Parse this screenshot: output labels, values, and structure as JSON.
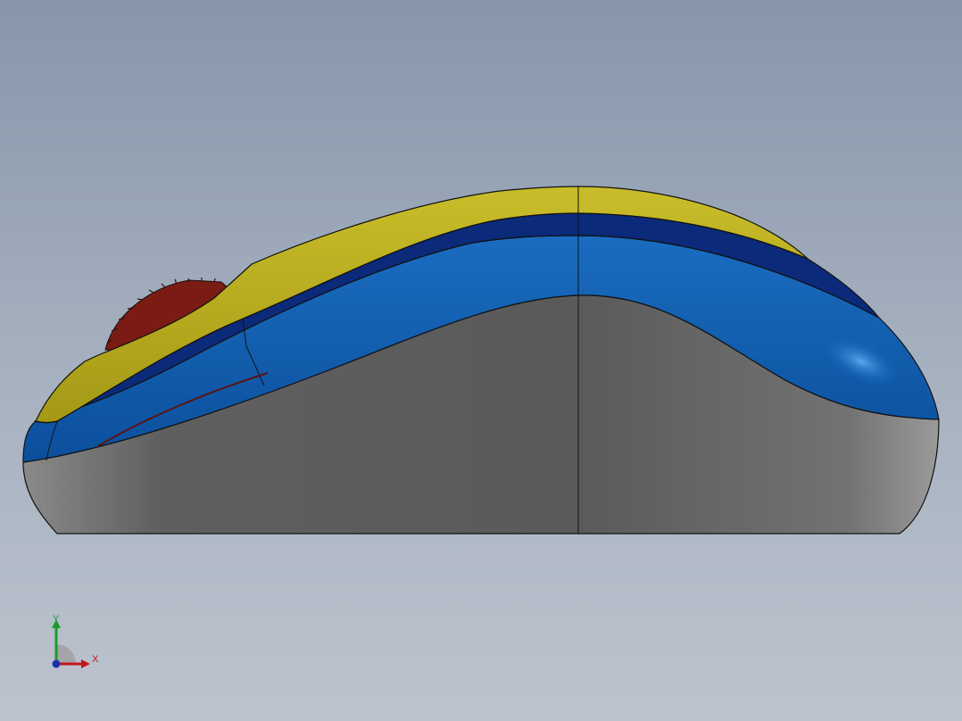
{
  "viewport": {
    "background_top": "#8796ab",
    "background_bottom": "#bcc3ce"
  },
  "model": {
    "colors": {
      "shell_top": "#b5a91b",
      "band_dark": "#0b2a7a",
      "band_blue": "#0e5fb3",
      "band_highlight": "#4a9be6",
      "base_gray": "#6a6a6a",
      "base_gray_dark": "#555555",
      "wheel": "#7a1c14",
      "edge": "#111111"
    }
  },
  "triad": {
    "x_label": "X",
    "y_label": "Y",
    "x_color": "#c4161c",
    "y_color": "#1a9c2a",
    "z_color": "#1c2fa8"
  }
}
